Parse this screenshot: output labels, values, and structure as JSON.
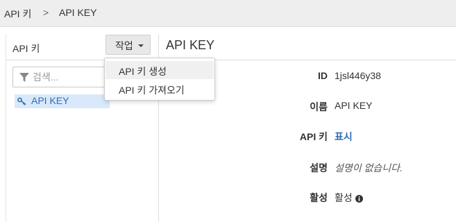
{
  "breadcrumb": {
    "root": "API 키",
    "separator": ">",
    "current": "API KEY"
  },
  "left_panel": {
    "title": "API 키",
    "actions_label": "작업",
    "search_placeholder": "검색...",
    "items": [
      {
        "label": "API KEY"
      }
    ]
  },
  "dropdown": {
    "items": [
      {
        "label": "API 키 생성"
      },
      {
        "label": "API 키 가져오기"
      }
    ]
  },
  "detail": {
    "title": "API KEY",
    "fields": {
      "id": {
        "label": "ID",
        "value": "1jsl446y38"
      },
      "name": {
        "label": "이름",
        "value": "API KEY"
      },
      "api_key": {
        "label": "API 키",
        "value": "표시"
      },
      "description": {
        "label": "설명",
        "value": "설명이 없습니다."
      },
      "enabled": {
        "label": "활성",
        "value": "활성"
      }
    }
  },
  "colors": {
    "link": "#2d6db5",
    "selected_bg": "#d9e9fa",
    "header_bg": "#eeeeee"
  }
}
